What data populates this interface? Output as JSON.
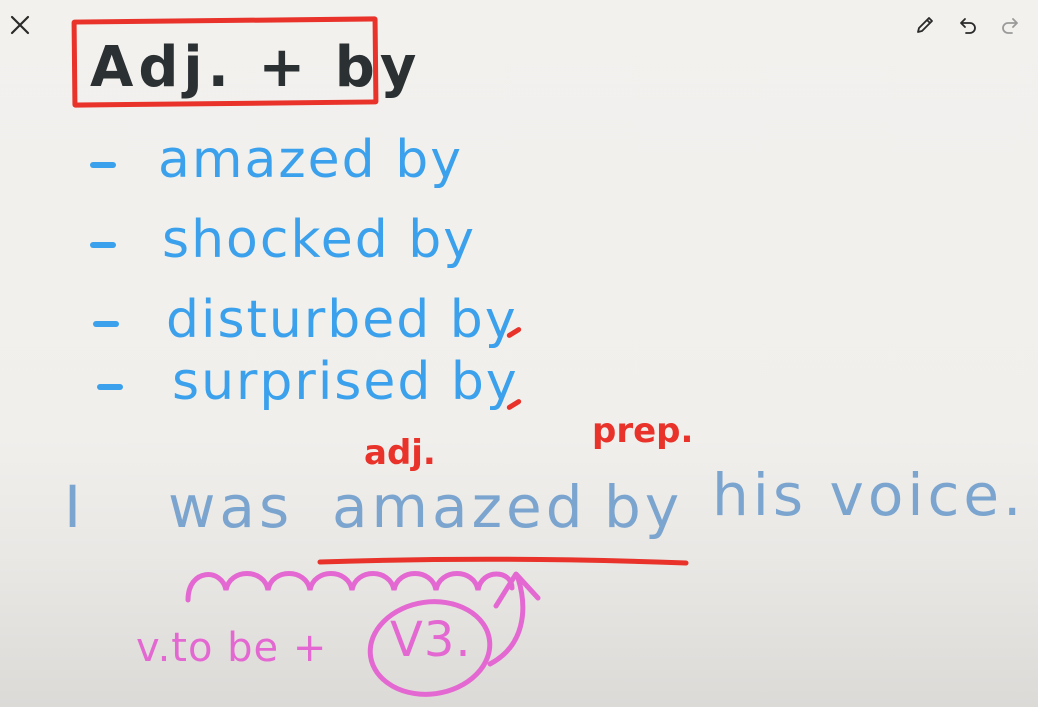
{
  "toolbar": {
    "close_icon": "close-icon",
    "pen_icon": "pencil-icon",
    "undo_icon": "undo-icon",
    "redo_icon": "redo-icon"
  },
  "note": {
    "title": "Adj. + by",
    "items": [
      "amazed by",
      "shocked by",
      "disturbed by",
      "surprised by"
    ],
    "annotation_adj": "adj.",
    "annotation_prep": "prep.",
    "sentence": {
      "w1": "I",
      "w2": "was",
      "w3": "amazed",
      "w4": "by",
      "w5": "his voice."
    },
    "formula_left": "v.to be +",
    "formula_right": "V3."
  },
  "colors": {
    "ink_dark": "#2b3033",
    "ink_blue": "#3ba1ec",
    "ink_sentence": "#7ba5cf",
    "ink_red": "#e8322a",
    "ink_pink": "#e468d1"
  }
}
